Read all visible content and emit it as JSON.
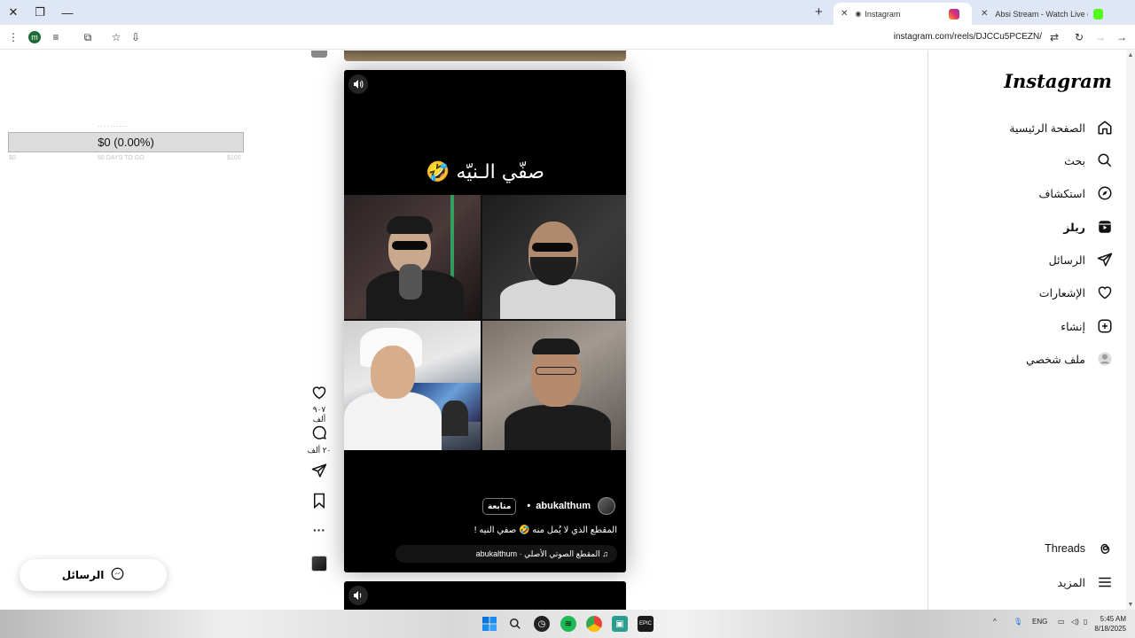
{
  "browser": {
    "tabs": [
      {
        "label": "Instagram",
        "active": true
      },
      {
        "label": "Absi Stream - Watch Live on Ki",
        "active": false
      }
    ],
    "url": "instagram.com/reels/DJCCu5PCEZN/",
    "profile_initial": "m"
  },
  "widget": {
    "label": "..........",
    "value": "$0 (0.00%)",
    "foot_left": "$0",
    "foot_mid": "60 DAYS TO GO",
    "foot_right": "$100"
  },
  "reel": {
    "overlay_text": "صفّي الـنيّه 🤣",
    "username": "abukalthum",
    "follow_label": "متابعة",
    "separator": "•",
    "caption": "المقطع الذي لا يُمل منه 🤣 صفي النيه !",
    "audio": "♫ المقطع الصوتي الأصلي · abukalthum"
  },
  "actions": {
    "likes": "٩٠٧ ألف",
    "comments": "٢٠ ألف"
  },
  "nav": {
    "logo": "Instagram",
    "items": [
      {
        "label": "الصفحة الرئيسية",
        "icon": "home-icon"
      },
      {
        "label": "بحث",
        "icon": "search-icon"
      },
      {
        "label": "استكشاف",
        "icon": "compass-icon"
      },
      {
        "label": "ريلز",
        "icon": "reels-icon"
      },
      {
        "label": "الرسائل",
        "icon": "messages-icon"
      },
      {
        "label": "الإشعارات",
        "icon": "heart-icon"
      },
      {
        "label": "إنشاء",
        "icon": "create-icon"
      },
      {
        "label": "ملف شخصي",
        "icon": "profile-icon"
      }
    ],
    "threads": "Threads",
    "more": "المزيد"
  },
  "messages_pill": "الرسائل",
  "taskbar": {
    "lang": "ENG",
    "time": "5:45 AM",
    "date": "8/18/2025"
  }
}
